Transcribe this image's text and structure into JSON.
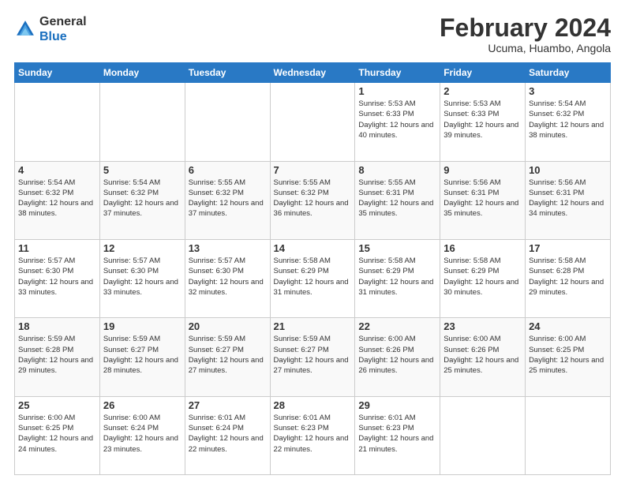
{
  "header": {
    "logo_general": "General",
    "logo_blue": "Blue",
    "month_title": "February 2024",
    "location": "Ucuma, Huambo, Angola"
  },
  "days_of_week": [
    "Sunday",
    "Monday",
    "Tuesday",
    "Wednesday",
    "Thursday",
    "Friday",
    "Saturday"
  ],
  "weeks": [
    [
      {
        "day": "",
        "sunrise": "",
        "sunset": "",
        "daylight": ""
      },
      {
        "day": "",
        "sunrise": "",
        "sunset": "",
        "daylight": ""
      },
      {
        "day": "",
        "sunrise": "",
        "sunset": "",
        "daylight": ""
      },
      {
        "day": "",
        "sunrise": "",
        "sunset": "",
        "daylight": ""
      },
      {
        "day": "1",
        "sunrise": "5:53 AM",
        "sunset": "6:33 PM",
        "daylight": "12 hours and 40 minutes."
      },
      {
        "day": "2",
        "sunrise": "5:53 AM",
        "sunset": "6:33 PM",
        "daylight": "12 hours and 39 minutes."
      },
      {
        "day": "3",
        "sunrise": "5:54 AM",
        "sunset": "6:32 PM",
        "daylight": "12 hours and 38 minutes."
      }
    ],
    [
      {
        "day": "4",
        "sunrise": "5:54 AM",
        "sunset": "6:32 PM",
        "daylight": "12 hours and 38 minutes."
      },
      {
        "day": "5",
        "sunrise": "5:54 AM",
        "sunset": "6:32 PM",
        "daylight": "12 hours and 37 minutes."
      },
      {
        "day": "6",
        "sunrise": "5:55 AM",
        "sunset": "6:32 PM",
        "daylight": "12 hours and 37 minutes."
      },
      {
        "day": "7",
        "sunrise": "5:55 AM",
        "sunset": "6:32 PM",
        "daylight": "12 hours and 36 minutes."
      },
      {
        "day": "8",
        "sunrise": "5:55 AM",
        "sunset": "6:31 PM",
        "daylight": "12 hours and 35 minutes."
      },
      {
        "day": "9",
        "sunrise": "5:56 AM",
        "sunset": "6:31 PM",
        "daylight": "12 hours and 35 minutes."
      },
      {
        "day": "10",
        "sunrise": "5:56 AM",
        "sunset": "6:31 PM",
        "daylight": "12 hours and 34 minutes."
      }
    ],
    [
      {
        "day": "11",
        "sunrise": "5:57 AM",
        "sunset": "6:30 PM",
        "daylight": "12 hours and 33 minutes."
      },
      {
        "day": "12",
        "sunrise": "5:57 AM",
        "sunset": "6:30 PM",
        "daylight": "12 hours and 33 minutes."
      },
      {
        "day": "13",
        "sunrise": "5:57 AM",
        "sunset": "6:30 PM",
        "daylight": "12 hours and 32 minutes."
      },
      {
        "day": "14",
        "sunrise": "5:58 AM",
        "sunset": "6:29 PM",
        "daylight": "12 hours and 31 minutes."
      },
      {
        "day": "15",
        "sunrise": "5:58 AM",
        "sunset": "6:29 PM",
        "daylight": "12 hours and 31 minutes."
      },
      {
        "day": "16",
        "sunrise": "5:58 AM",
        "sunset": "6:29 PM",
        "daylight": "12 hours and 30 minutes."
      },
      {
        "day": "17",
        "sunrise": "5:58 AM",
        "sunset": "6:28 PM",
        "daylight": "12 hours and 29 minutes."
      }
    ],
    [
      {
        "day": "18",
        "sunrise": "5:59 AM",
        "sunset": "6:28 PM",
        "daylight": "12 hours and 29 minutes."
      },
      {
        "day": "19",
        "sunrise": "5:59 AM",
        "sunset": "6:27 PM",
        "daylight": "12 hours and 28 minutes."
      },
      {
        "day": "20",
        "sunrise": "5:59 AM",
        "sunset": "6:27 PM",
        "daylight": "12 hours and 27 minutes."
      },
      {
        "day": "21",
        "sunrise": "5:59 AM",
        "sunset": "6:27 PM",
        "daylight": "12 hours and 27 minutes."
      },
      {
        "day": "22",
        "sunrise": "6:00 AM",
        "sunset": "6:26 PM",
        "daylight": "12 hours and 26 minutes."
      },
      {
        "day": "23",
        "sunrise": "6:00 AM",
        "sunset": "6:26 PM",
        "daylight": "12 hours and 25 minutes."
      },
      {
        "day": "24",
        "sunrise": "6:00 AM",
        "sunset": "6:25 PM",
        "daylight": "12 hours and 25 minutes."
      }
    ],
    [
      {
        "day": "25",
        "sunrise": "6:00 AM",
        "sunset": "6:25 PM",
        "daylight": "12 hours and 24 minutes."
      },
      {
        "day": "26",
        "sunrise": "6:00 AM",
        "sunset": "6:24 PM",
        "daylight": "12 hours and 23 minutes."
      },
      {
        "day": "27",
        "sunrise": "6:01 AM",
        "sunset": "6:24 PM",
        "daylight": "12 hours and 22 minutes."
      },
      {
        "day": "28",
        "sunrise": "6:01 AM",
        "sunset": "6:23 PM",
        "daylight": "12 hours and 22 minutes."
      },
      {
        "day": "29",
        "sunrise": "6:01 AM",
        "sunset": "6:23 PM",
        "daylight": "12 hours and 21 minutes."
      },
      {
        "day": "",
        "sunrise": "",
        "sunset": "",
        "daylight": ""
      },
      {
        "day": "",
        "sunrise": "",
        "sunset": "",
        "daylight": ""
      }
    ]
  ]
}
